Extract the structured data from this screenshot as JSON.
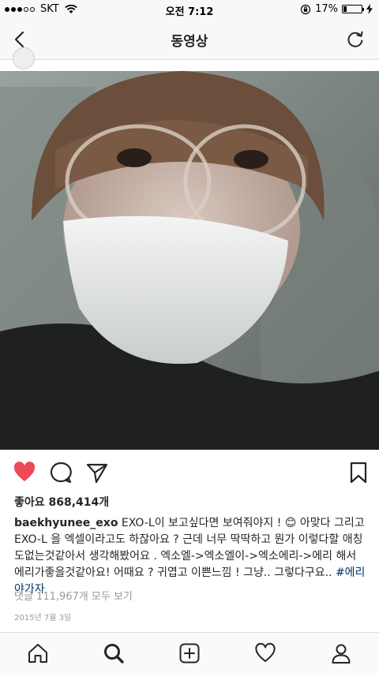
{
  "status": {
    "carrier": "SKT",
    "time": "오전 7:12",
    "battery_percent": "17%",
    "battery_level": 0.17
  },
  "nav": {
    "title": "동영상",
    "back_icon": "chevron-left-icon",
    "refresh_icon": "refresh-icon"
  },
  "post": {
    "likes": "좋아요 868,414개",
    "username": "baekhyunee_exo",
    "caption_part1": " EXO-L이 보고싶다면 보여줘야지 ! ",
    "emoji": "😊",
    "caption_part2": " 아맞다 그리고 EXO-L 을 엑셀이라고도 하잖아요 ? 근데 너무 딱딱하고 뭔가 이렇다할 애칭도없는것같아서 생각해봤어요 . 엑소엘->엑소엘이->엑소에리->에리 해서 에리가좋을것같아요! 어때요 ? 귀엽고 이쁜느낌 ! 그냥.. 그렇다구요.. ",
    "hashtag": "#에리야가자",
    "comments_link": "댓글 111,967개 모두 보기",
    "date": "2015년 7월 3일"
  },
  "icons": {
    "like": "heart-filled-icon",
    "comment": "comment-bubble-icon",
    "share": "send-icon",
    "save": "bookmark-icon"
  },
  "colors": {
    "like_red": "#ed4956",
    "hashtag_blue": "#003569",
    "muted_gray": "#999999"
  },
  "tabbar": {
    "items": [
      "home-icon",
      "search-icon",
      "add-post-icon",
      "activity-heart-icon",
      "profile-icon"
    ]
  }
}
